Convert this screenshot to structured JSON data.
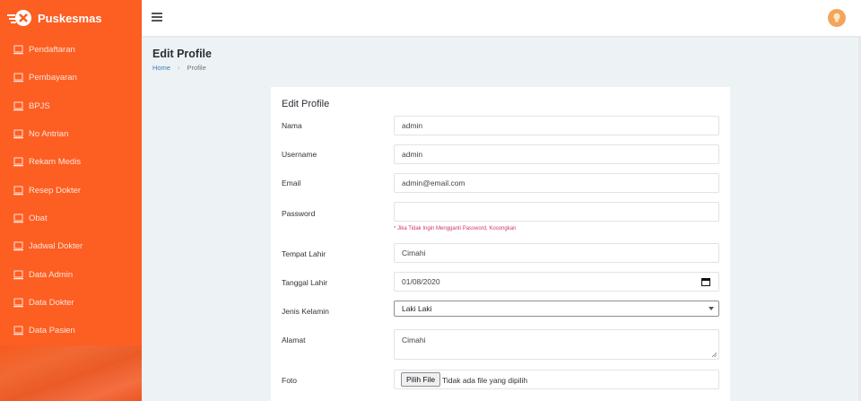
{
  "brand": {
    "name": "Puskesmas"
  },
  "sidebar": {
    "items": [
      {
        "label": "Pendaftaran",
        "icon": "monitor-icon"
      },
      {
        "label": "Pembayaran",
        "icon": "monitor-icon"
      },
      {
        "label": "BPJS",
        "icon": "monitor-icon"
      },
      {
        "label": "No Antrian",
        "icon": "monitor-icon"
      },
      {
        "label": "Rekam Medis",
        "icon": "monitor-icon"
      },
      {
        "label": "Resep Dokter",
        "icon": "monitor-icon"
      },
      {
        "label": "Obat",
        "icon": "monitor-icon"
      },
      {
        "label": "Jadwal Dokter",
        "icon": "monitor-icon"
      },
      {
        "label": "Data Admin",
        "icon": "monitor-icon"
      },
      {
        "label": "Data Dokter",
        "icon": "monitor-icon"
      },
      {
        "label": "Data Pasien",
        "icon": "monitor-icon"
      }
    ]
  },
  "header": {
    "title": "Edit Profile",
    "breadcrumb": {
      "home": "Home",
      "current": "Profile"
    }
  },
  "form": {
    "title": "Edit Profile",
    "nama": {
      "label": "Nama",
      "value": "admin"
    },
    "username": {
      "label": "Username",
      "value": "admin"
    },
    "email": {
      "label": "Email",
      "value": "admin@email.com"
    },
    "password": {
      "label": "Password",
      "value": "",
      "hint": "* Jika Tidak Ingin Mengganti Password, Kosongkan"
    },
    "tempat_lahir": {
      "label": "Tempat Lahir",
      "value": "Cimahi"
    },
    "tanggal_lahir": {
      "label": "Tanggal Lahir",
      "value": "01/08/2020"
    },
    "jenis_kelamin": {
      "label": "Jenis Kelamin",
      "value": "Laki Laki"
    },
    "alamat": {
      "label": "Alamat",
      "value": "Cimahi"
    },
    "foto": {
      "label": "Foto",
      "button": "Pilih File",
      "status": "Tidak ada file yang dipilih"
    }
  },
  "colors": {
    "sidebar": "#fd5e22",
    "accent": "#f3a55c",
    "hint": "#d1366e",
    "link": "#3b7bbf"
  }
}
